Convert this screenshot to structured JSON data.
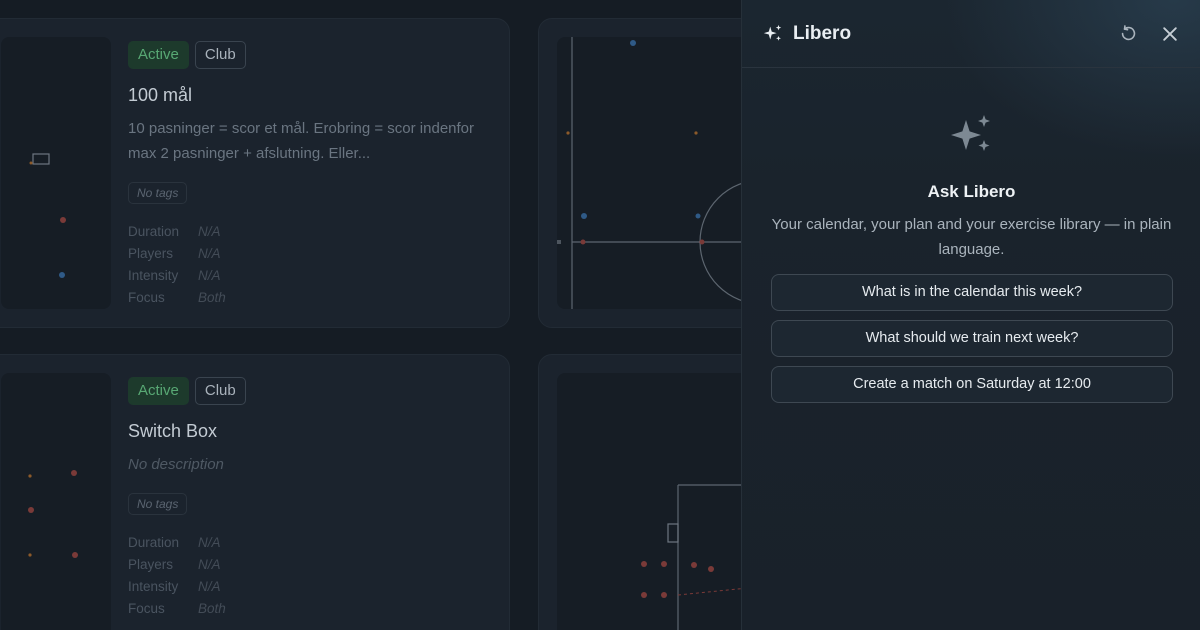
{
  "exercises": [
    {
      "status": "Active",
      "scope": "Club",
      "title": "100 mål",
      "description": "10 pasninger = scor et mål. Erobring = scor indenfor max 2 pasninger + afslutning. Eller...",
      "tags": "No tags",
      "stats": [
        {
          "label": "Duration",
          "value": "N/A"
        },
        {
          "label": "Players",
          "value": "N/A"
        },
        {
          "label": "Intensity",
          "value": "N/A"
        },
        {
          "label": "Focus",
          "value": "Both"
        }
      ]
    },
    {
      "status": "Active",
      "scope": "Club",
      "title": "Switch Box",
      "description": "No description",
      "tags": "No tags",
      "stats": [
        {
          "label": "Duration",
          "value": "N/A"
        },
        {
          "label": "Players",
          "value": "N/A"
        },
        {
          "label": "Intensity",
          "value": "N/A"
        },
        {
          "label": "Focus",
          "value": "Both"
        }
      ]
    }
  ],
  "assistant": {
    "name": "Libero",
    "icon": "sparkles-icon",
    "reset_icon": "refresh-icon",
    "close_icon": "close-icon",
    "heading": "Ask Libero",
    "subtitle": "Your calendar, your plan and your exercise library — in plain language.",
    "suggestions": [
      "What is in the calendar this week?",
      "What should we train next week?",
      "Create a match on Saturday at 12:00"
    ]
  },
  "colors": {
    "background": "#151c24",
    "panel": "#1a232c",
    "active_badge": "#58a874",
    "player_red": "#8a3e3a",
    "player_blue": "#2f5a87",
    "player_orange": "#8c5a2a"
  }
}
